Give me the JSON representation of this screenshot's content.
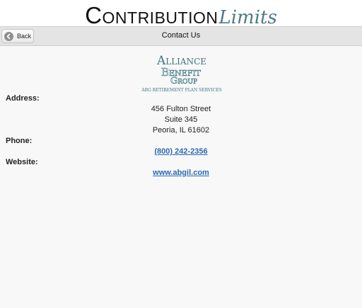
{
  "header": {
    "title_main": "Contribution",
    "title_script": "Limits"
  },
  "toolbar": {
    "back_label": "Back",
    "page_title": "Contact Us"
  },
  "logo": {
    "line1": "Alliance",
    "line2": "Benefit",
    "line3": "Group",
    "tagline": "ABG RETIREMENT PLAN SERVICES",
    "color": "#3f7480"
  },
  "contact": {
    "address_label": "Address:",
    "address_lines": [
      "456 Fulton Street",
      "Suite 345",
      "Peoria, IL 61602"
    ],
    "phone_label": "Phone:",
    "phone": "(800) 242-2356",
    "website_label": "Website:",
    "website": "www.abgil.com"
  }
}
